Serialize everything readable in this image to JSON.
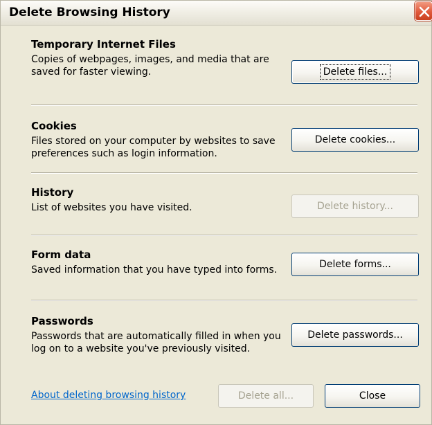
{
  "window": {
    "title": "Delete Browsing History"
  },
  "sections": [
    {
      "title": "Temporary Internet Files",
      "description": "Copies of webpages, images, and media that are saved for faster viewing.",
      "button": "Delete files...",
      "enabled": true
    },
    {
      "title": "Cookies",
      "description": "Files stored on your computer by websites to save preferences such as login information.",
      "button": "Delete cookies...",
      "enabled": true
    },
    {
      "title": "History",
      "description": "List of websites you have visited.",
      "button": "Delete history...",
      "enabled": false
    },
    {
      "title": "Form data",
      "description": "Saved information that you have typed into forms.",
      "button": "Delete forms...",
      "enabled": true
    },
    {
      "title": "Passwords",
      "description": "Passwords that are automatically filled in when you log on to a website you've previously visited.",
      "button": "Delete passwords...",
      "enabled": true
    }
  ],
  "footer": {
    "about_link": "About deleting browsing history",
    "delete_all": "Delete all...",
    "close": "Close"
  },
  "colors": {
    "dialog_background": "#ece9d8",
    "link": "#0066cc",
    "close_button": "#e0593b",
    "button_border": "#003c74",
    "disabled_text": "#a5a290"
  }
}
